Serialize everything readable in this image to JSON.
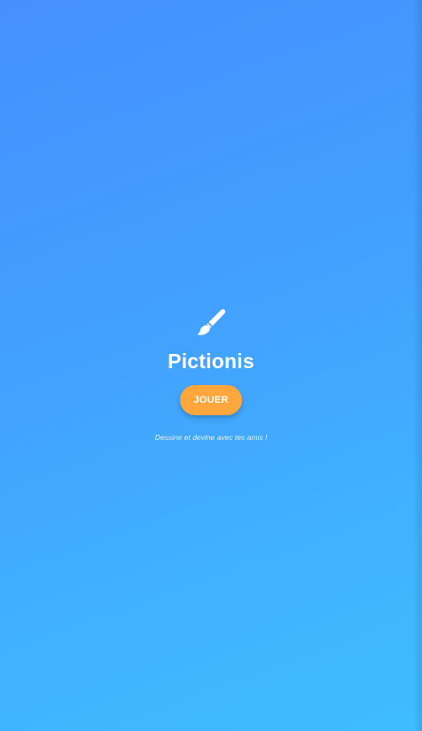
{
  "app": {
    "title": "Pictionis",
    "play_label": "JOUER",
    "tagline": "Dessine et devine avec tes amis !",
    "icon": "paintbrush-icon"
  },
  "colors": {
    "background_top": "#4690fd",
    "background_bottom": "#3fbcff",
    "accent": "#ffa63d",
    "text": "#ffffff"
  }
}
